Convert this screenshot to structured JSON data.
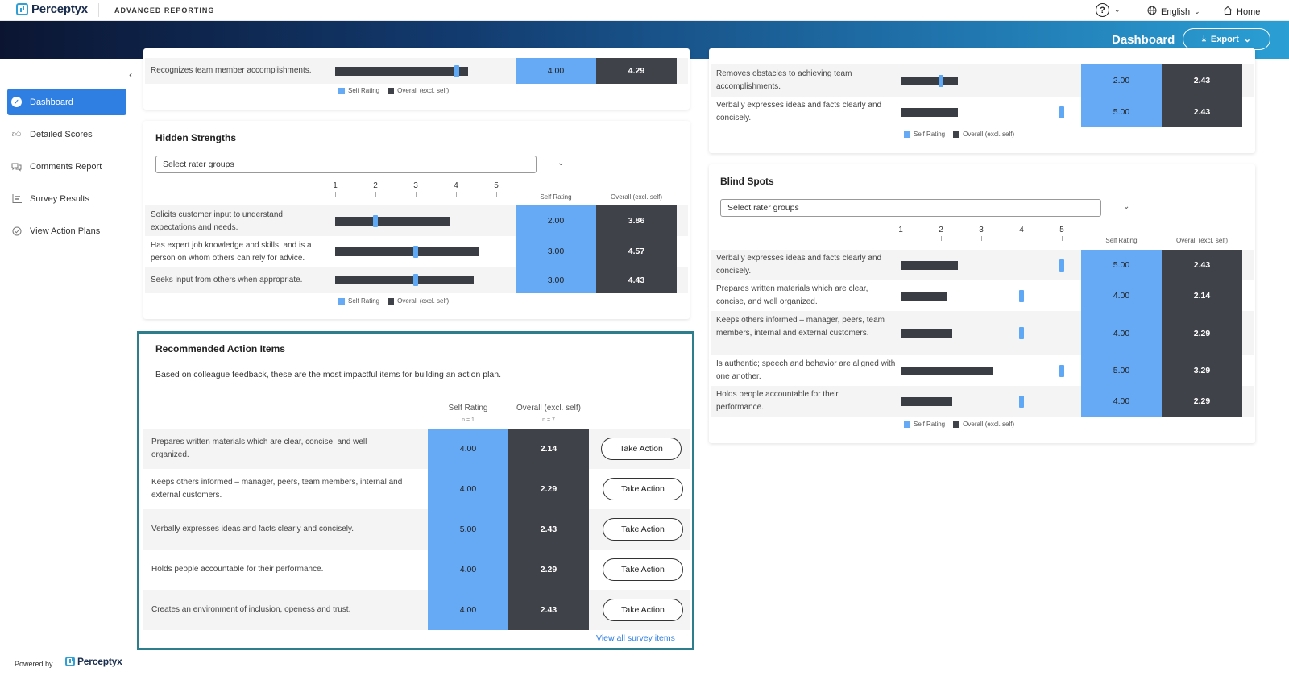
{
  "app": {
    "brand": "Perceptyx",
    "section": "ADVANCED REPORTING",
    "help_icon": "question-circle-icon",
    "language": "English",
    "home": "Home"
  },
  "banner": {
    "title": "Dashboard",
    "export_label": "Export"
  },
  "sidebar": {
    "items": [
      {
        "label": "Dashboard",
        "icon": "check-circle-icon",
        "active": true
      },
      {
        "label": "Detailed Scores",
        "icon": "thumbs-up-icon"
      },
      {
        "label": "Comments Report",
        "icon": "chat-bubbles-icon"
      },
      {
        "label": "Survey Results",
        "icon": "list-bars-icon"
      },
      {
        "label": "View Action Plans",
        "icon": "check-outline-icon"
      }
    ],
    "powered_by": "Powered by",
    "powered_brand": "Perceptyx"
  },
  "legend": {
    "self": "Self Rating",
    "overall": "Overall (excl. self)"
  },
  "colors": {
    "self": "#66aaf6",
    "overall": "#40424a",
    "accent": "#2f7fe3",
    "highlight_border": "#2d7d8d"
  },
  "top_left_partial": {
    "rows": [
      {
        "text": "Recognizes team member accomplishments.",
        "self": "4.00",
        "overall": "4.29",
        "self_val": 4.0,
        "overall_val": 4.29
      }
    ]
  },
  "hidden_strengths": {
    "title": "Hidden Strengths",
    "select_placeholder": "Select rater groups",
    "scale": [
      "1",
      "2",
      "3",
      "4",
      "5"
    ],
    "col_self": "Self Rating",
    "col_overall": "Overall (excl. self)",
    "rows": [
      {
        "text": "Solicits customer input to understand expectations and needs.",
        "self": "2.00",
        "overall": "3.86",
        "self_val": 2.0,
        "overall_val": 3.86
      },
      {
        "text": "Has expert job knowledge and skills, and is a person on whom others can rely for advice.",
        "self": "3.00",
        "overall": "4.57",
        "self_val": 3.0,
        "overall_val": 4.57
      },
      {
        "text": "Seeks input from others when appropriate.",
        "self": "3.00",
        "overall": "4.43",
        "self_val": 3.0,
        "overall_val": 4.43
      }
    ]
  },
  "recommended": {
    "title": "Recommended Action Items",
    "description": "Based on colleague feedback, these are the most impactful items for building an action plan.",
    "col_self": "Self Rating",
    "col_self_n": "n = 1",
    "col_overall": "Overall (excl. self)",
    "col_overall_n": "n = 7",
    "button_label": "Take Action",
    "view_all": "View all survey items",
    "rows": [
      {
        "text": "Prepares written materials which are clear, concise, and well organized.",
        "self": "4.00",
        "overall": "2.14"
      },
      {
        "text": "Keeps others informed – manager, peers, team members, internal and external customers.",
        "self": "4.00",
        "overall": "2.29"
      },
      {
        "text": "Verbally expresses ideas and facts clearly and concisely.",
        "self": "5.00",
        "overall": "2.43"
      },
      {
        "text": "Holds people accountable for their performance.",
        "self": "4.00",
        "overall": "2.29"
      },
      {
        "text": "Creates an environment of inclusion, openess and trust.",
        "self": "4.00",
        "overall": "2.43"
      }
    ]
  },
  "top_right_partial": {
    "rows": [
      {
        "text": "Removes obstacles to achieving team accomplishments.",
        "self": "2.00",
        "overall": "2.43",
        "self_val": 2.0,
        "overall_val": 2.43
      },
      {
        "text": "Verbally expresses ideas and facts clearly and concisely.",
        "self": "5.00",
        "overall": "2.43",
        "self_val": 5.0,
        "overall_val": 2.43
      }
    ]
  },
  "blind_spots": {
    "title": "Blind Spots",
    "select_placeholder": "Select rater groups",
    "scale": [
      "1",
      "2",
      "3",
      "4",
      "5"
    ],
    "col_self": "Self Rating",
    "col_overall": "Overall (excl. self)",
    "rows": [
      {
        "text": "Verbally expresses ideas and facts clearly and concisely.",
        "self": "5.00",
        "overall": "2.43",
        "self_val": 5.0,
        "overall_val": 2.43
      },
      {
        "text": "Prepares written materials which are clear, concise, and well organized.",
        "self": "4.00",
        "overall": "2.14",
        "self_val": 4.0,
        "overall_val": 2.14
      },
      {
        "text": "Keeps others informed – manager, peers, team members, internal and external customers.",
        "self": "4.00",
        "overall": "2.29",
        "self_val": 4.0,
        "overall_val": 2.29
      },
      {
        "text": "Is authentic; speech and behavior are aligned with one another.",
        "self": "5.00",
        "overall": "3.29",
        "self_val": 5.0,
        "overall_val": 3.29
      },
      {
        "text": "Holds people accountable for their performance.",
        "self": "4.00",
        "overall": "2.29",
        "self_val": 4.0,
        "overall_val": 2.29
      }
    ]
  }
}
